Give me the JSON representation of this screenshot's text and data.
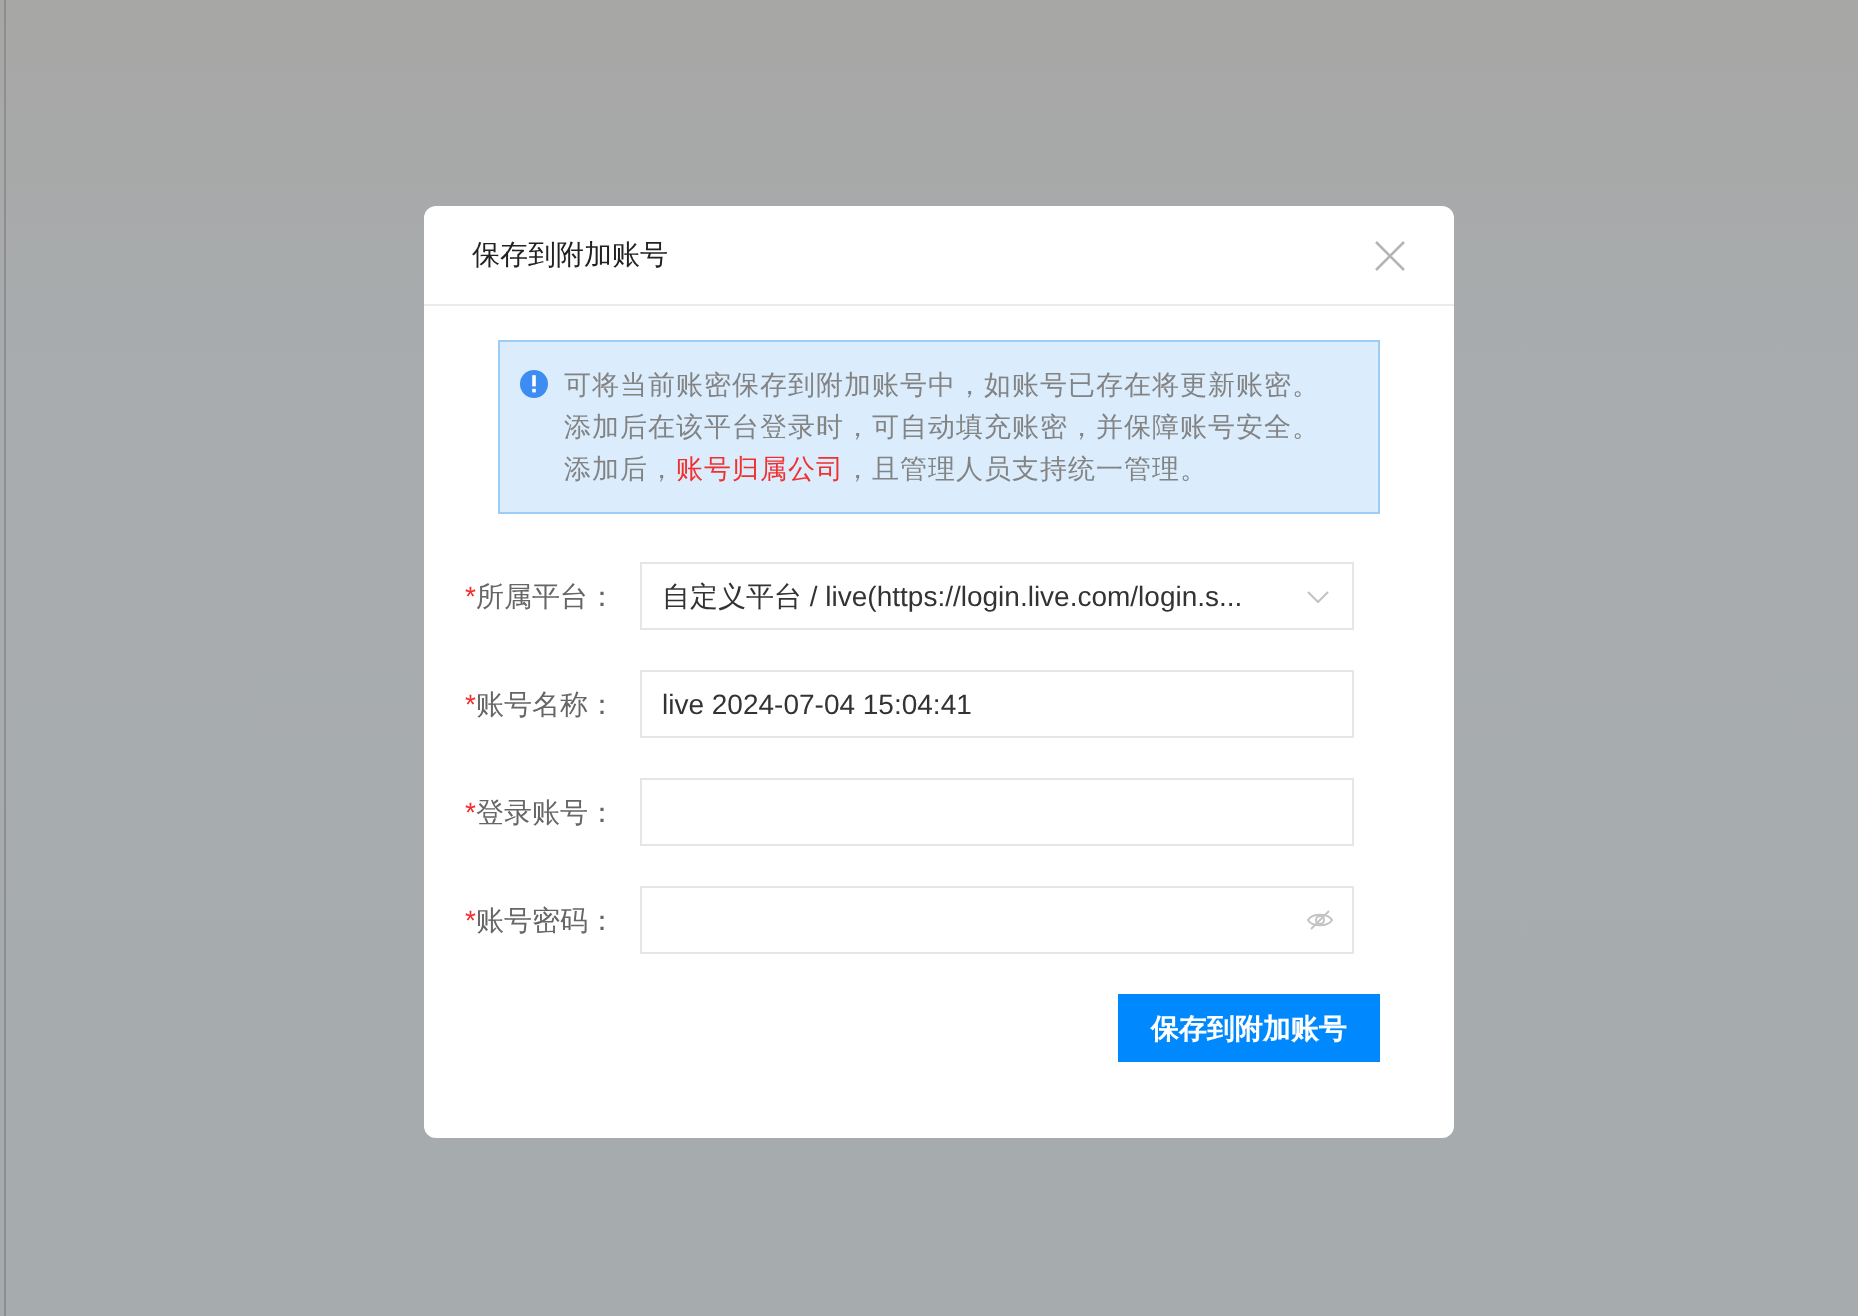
{
  "dialog": {
    "title": "保存到附加账号",
    "notice": {
      "lines": [
        [
          {
            "text": "可将当前账密保存到附加账号中，如账号已存在将更新账密。",
            "highlight": false
          }
        ],
        [
          {
            "text": "添加后在该平台登录时，可自动填充账密，并保障账号安全。",
            "highlight": false
          }
        ],
        [
          {
            "text": "添加后，",
            "highlight": false
          },
          {
            "text": "账号归属公司",
            "highlight": true
          },
          {
            "text": "，且管理人员支持统一管理。",
            "highlight": false
          }
        ]
      ]
    },
    "fields": [
      {
        "kind": "select",
        "marker": "*",
        "label": "所属平台：",
        "value": "自定义平台 / live(https://login.live.com/login.s..."
      },
      {
        "kind": "text",
        "marker": "*",
        "label": "账号名称：",
        "value": "live 2024-07-04 15:04:41"
      },
      {
        "kind": "text",
        "marker": "*",
        "label": "登录账号："
      },
      {
        "kind": "password",
        "marker": "*",
        "label": "账号密码："
      }
    ],
    "submit": "保存到附加账号"
  }
}
